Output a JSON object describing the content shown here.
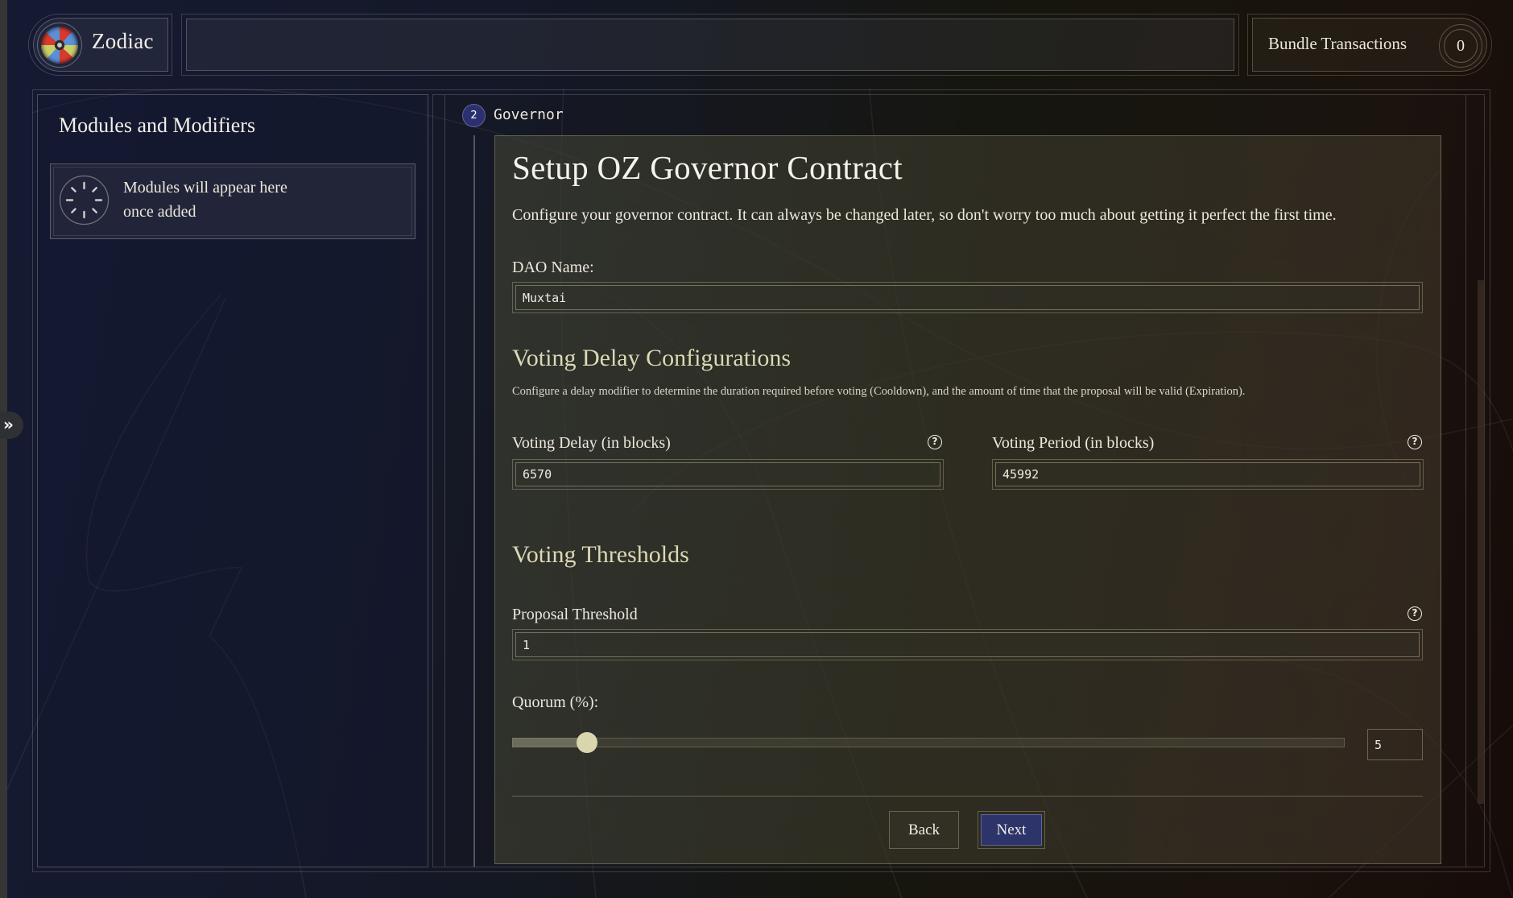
{
  "header": {
    "app_name": "Zodiac",
    "logo_icon": "zodiac-logo-icon",
    "bundle_label": "Bundle Transactions",
    "bundle_count": "0"
  },
  "sidebar": {
    "title": "Modules and Modifiers",
    "empty_state_icon": "spinner-icon",
    "empty_state_line1": "Modules will appear here",
    "empty_state_line2": "once added",
    "expand_icon": "chevrons-right-icon",
    "expand_glyph": "»"
  },
  "step": {
    "number": "2",
    "label": "Governor"
  },
  "form": {
    "title": "Setup OZ Governor Contract",
    "description": "Configure your governor contract. It can always be changed later, so don't worry too much about getting it perfect the first time.",
    "dao_name_label": "DAO Name:",
    "dao_name_value": "Muxtai",
    "voting_delay_section": {
      "heading": "Voting Delay Configurations",
      "description": "Configure a delay modifier to determine the duration required before voting (Cooldown), and the amount of time that the proposal will be valid (Expiration).",
      "voting_delay_label": "Voting Delay (in blocks)",
      "voting_delay_value": "6570",
      "voting_period_label": "Voting Period (in blocks)",
      "voting_period_value": "45992"
    },
    "thresholds_section": {
      "heading": "Voting Thresholds",
      "proposal_threshold_label": "Proposal Threshold",
      "proposal_threshold_value": "1",
      "quorum_label": "Quorum (%):",
      "quorum_value": "5",
      "quorum_slider_percent": 5
    },
    "help_glyph": "?",
    "back_label": "Back",
    "next_label": "Next"
  },
  "colors": {
    "accent_blue": "#2c346a",
    "section_heading": "#dcd8b4",
    "slider_thumb": "#d9d6ad"
  }
}
